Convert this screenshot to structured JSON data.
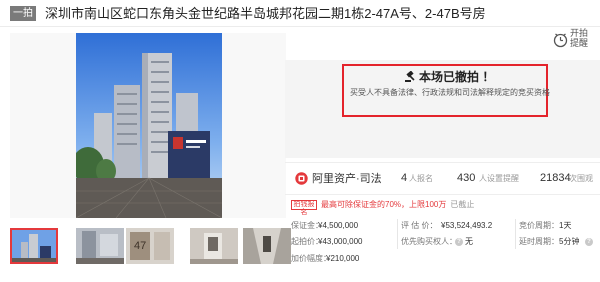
{
  "header": {
    "badge": "一拍",
    "title": "深圳市南山区蛇口东角头金世纪路半岛城邦花园二期1栋2-47A号、2-47B号房"
  },
  "reminder": {
    "label": "开拍提醒",
    "icon": "clock-icon"
  },
  "status": {
    "title": "本场已撤拍 ！",
    "description": "买受人不具备法律、行政法规和司法解释规定的竞买资格",
    "icon": "auction-hammer-icon",
    "box_color": "#e4232b"
  },
  "stats": {
    "logo": "阿里资产·司法",
    "signups": {
      "value": "4",
      "label": "人报名"
    },
    "reminders": {
      "value": "430",
      "label": "人设置提醒"
    },
    "views": {
      "value": "21834",
      "label": "次围观"
    }
  },
  "promo": {
    "tag": "拍钱报名",
    "text": "最高可除保证金的70%，上限100万",
    "suffix": "已截止"
  },
  "info": {
    "deposit": {
      "label": "保证金：",
      "value": "¥4,500,000"
    },
    "start_price": {
      "label": "起拍价：",
      "value": "¥43,000,000"
    },
    "increment": {
      "label": "加价幅度：",
      "value": "¥210,000"
    },
    "appraisal": {
      "label": "评 估 价：",
      "value": "¥53,524,493.2"
    },
    "priority": {
      "label": "优先购买权人：",
      "value": "无"
    },
    "bid_period": {
      "label": "竞价周期：",
      "value": "1天"
    },
    "delay_period": {
      "label": "延时周期：",
      "value": "5分钟"
    }
  },
  "colors": {
    "accent": "#e4393c",
    "status_border": "#e4232b"
  },
  "thumbnails": [
    "tower-photo",
    "lobby-photo",
    "unit-door-47-photo",
    "interior-photo",
    "corridor-photo"
  ]
}
